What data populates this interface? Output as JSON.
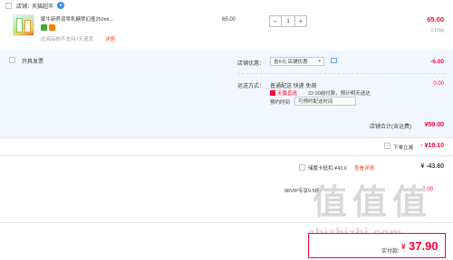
{
  "shop": {
    "label": "店铺：",
    "name": "天猫超市",
    "wangwang_icon": "wangwang-chat-icon"
  },
  "item": {
    "title": "蒙牛新养道零乳糖梦幻盖250ml...",
    "badges": [
      "badge-green",
      "badge-orange"
    ],
    "note": "此商品他不支持7天退货",
    "note_link": "详情",
    "unit_price": "65.00",
    "quantity": "1",
    "qty_minus": "−",
    "qty_plus": "+",
    "subtotal": "65.00",
    "weight": "3.15kg"
  },
  "invoice": {
    "label": "开具发票"
  },
  "discount": {
    "label": "店铺优惠：",
    "selected": "省6元:店铺优惠",
    "amount": "-6.00",
    "info_icon": "speech-bubble-icon"
  },
  "shipping": {
    "label": "运送方式：",
    "line1": "普通配送 快递 免邮",
    "line2_brand": "天猫直送",
    "line2_text": "22:00前付款，预计明天送达",
    "time_label": "预约时间",
    "time_input": "可预约配送时间",
    "amount": "0.00"
  },
  "shop_total": {
    "label": "店铺合计(含运费)",
    "amount": "¥59.00"
  },
  "instant_discount": {
    "label": "下单立减",
    "amount": "- ¥19.10",
    "check_icon": "check-icon"
  },
  "savings_card": {
    "label": "储蓄卡抵扣 ¥43.6",
    "link": "查看详情",
    "amount": "¥ -43.60"
  },
  "vip": {
    "label": "88VIP专享9.5折",
    "amount": "-2.00"
  },
  "final": {
    "label": "实付款:",
    "currency": "¥",
    "amount": "37.90"
  },
  "watermark": {
    "glyphs": [
      "值",
      "值",
      "值"
    ],
    "domain": "zhizhizhi.com"
  },
  "colors": {
    "accent": "#ff0036",
    "link": "#f40",
    "section_bg": "#f2f7ff"
  }
}
